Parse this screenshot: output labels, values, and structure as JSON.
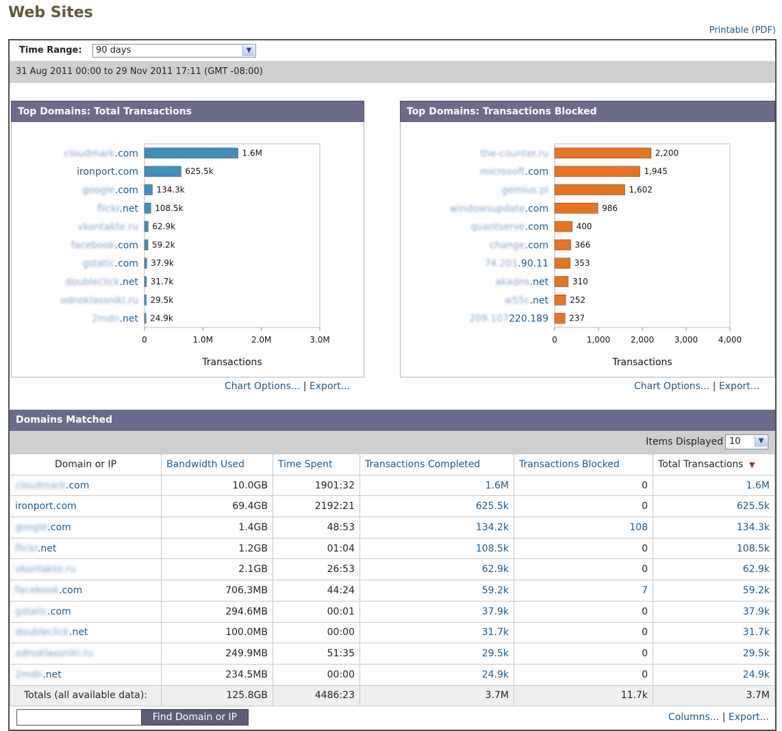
{
  "page": {
    "title": "Web Sites",
    "printable_link": "Printable (PDF)"
  },
  "time_range": {
    "label": "Time Range:",
    "selected": "90 days",
    "date_span": "31 Aug 2011 00:00 to 29 Nov 2011 17:11 (GMT -08:00)"
  },
  "links": {
    "chart_options": "Chart Options...",
    "export": "Export...",
    "separator": "|",
    "columns": "Columns..."
  },
  "colors": {
    "header_bar": "#6b6b8c",
    "bar_total": "#3f8fbf",
    "bar_blocked": "#ea7320",
    "link": "#1b5a8c"
  },
  "chart_data": [
    {
      "type": "bar",
      "orientation": "horizontal",
      "title": "Top Domains: Total Transactions",
      "xlabel": "Transactions",
      "categories": [
        {
          "prefix": "cloudmark",
          "suffix": ".com"
        },
        {
          "prefix": "",
          "suffix": "ironport.com"
        },
        {
          "prefix": "google",
          "suffix": ".com"
        },
        {
          "prefix": "flickr",
          "suffix": ".net"
        },
        {
          "prefix": "vkontakte.ru",
          "suffix": ""
        },
        {
          "prefix": "facebook",
          "suffix": ".com"
        },
        {
          "prefix": "gstatic",
          "suffix": ".com"
        },
        {
          "prefix": "doubleclick",
          "suffix": ".net"
        },
        {
          "prefix": "odnoklassniki.ru",
          "suffix": ""
        },
        {
          "prefix": "2mdn",
          "suffix": ".net"
        }
      ],
      "values": [
        1600000,
        625500,
        134300,
        108500,
        62900,
        59200,
        37900,
        31700,
        29500,
        24900
      ],
      "value_labels": [
        "1.6M",
        "625.5k",
        "134.3k",
        "108.5k",
        "62.9k",
        "59.2k",
        "37.9k",
        "31.7k",
        "29.5k",
        "24.9k"
      ],
      "xlim": [
        0,
        3000000
      ],
      "xticks": [
        0,
        1000000,
        2000000,
        3000000
      ],
      "xtick_labels": [
        "0",
        "1.0M",
        "2.0M",
        "3.0M"
      ],
      "color": "#3f8fbf"
    },
    {
      "type": "bar",
      "orientation": "horizontal",
      "title": "Top Domains: Transactions Blocked",
      "xlabel": "Transactions",
      "categories": [
        {
          "prefix": "the-counter.ru",
          "suffix": ""
        },
        {
          "prefix": "microsoft",
          "suffix": ".com"
        },
        {
          "prefix": "gemius.pl",
          "suffix": ""
        },
        {
          "prefix": "windowsupdate",
          "suffix": ".com"
        },
        {
          "prefix": "quantserve",
          "suffix": ".com"
        },
        {
          "prefix": "change",
          "suffix": ".com"
        },
        {
          "prefix": "74.201",
          "suffix": ".90.11"
        },
        {
          "prefix": "akadns",
          "suffix": ".net"
        },
        {
          "prefix": "w55c",
          "suffix": ".net"
        },
        {
          "prefix": "209.107",
          "suffix": "220.189"
        }
      ],
      "values": [
        2200,
        1945,
        1602,
        986,
        400,
        366,
        353,
        310,
        252,
        237
      ],
      "value_labels": [
        "2,200",
        "1,945",
        "1,602",
        "986",
        "400",
        "366",
        "353",
        "310",
        "252",
        "237"
      ],
      "xlim": [
        0,
        4000
      ],
      "xticks": [
        0,
        1000,
        2000,
        3000,
        4000
      ],
      "xtick_labels": [
        "0",
        "1,000",
        "2,000",
        "3,000",
        "4,000"
      ],
      "color": "#ea7320"
    }
  ],
  "domains": {
    "title": "Domains Matched",
    "items_label": "Items Displayed",
    "items_value": "10",
    "columns": [
      "Domain or IP",
      "Bandwidth Used",
      "Time Spent",
      "Transactions Completed",
      "Transactions Blocked",
      "Total Transactions"
    ],
    "sort_indicator": "▼",
    "rows": [
      {
        "prefix": "cloudmark",
        "suffix": ".com",
        "bandwidth": "10.0GB",
        "time": "1901:32",
        "completed": "1.6M",
        "blocked": "0",
        "total": "1.6M"
      },
      {
        "prefix": "",
        "suffix": "ironport.com",
        "bandwidth": "69.4GB",
        "time": "2192:21",
        "completed": "625.5k",
        "blocked": "0",
        "total": "625.5k"
      },
      {
        "prefix": "google",
        "suffix": ".com",
        "bandwidth": "1.4GB",
        "time": "48:53",
        "completed": "134.2k",
        "blocked": "108",
        "total": "134.3k"
      },
      {
        "prefix": "flickr",
        "suffix": ".net",
        "bandwidth": "1.2GB",
        "time": "01:04",
        "completed": "108.5k",
        "blocked": "0",
        "total": "108.5k"
      },
      {
        "prefix": "vkontakte.ru",
        "suffix": "",
        "bandwidth": "2.1GB",
        "time": "26:53",
        "completed": "62.9k",
        "blocked": "0",
        "total": "62.9k"
      },
      {
        "prefix": "facebook",
        "suffix": ".com",
        "bandwidth": "706.3MB",
        "time": "44:24",
        "completed": "59.2k",
        "blocked": "7",
        "total": "59.2k"
      },
      {
        "prefix": "gstatic",
        "suffix": ".com",
        "bandwidth": "294.6MB",
        "time": "00:01",
        "completed": "37.9k",
        "blocked": "0",
        "total": "37.9k"
      },
      {
        "prefix": "doubleclick",
        "suffix": ".net",
        "bandwidth": "100.0MB",
        "time": "00:00",
        "completed": "31.7k",
        "blocked": "0",
        "total": "31.7k"
      },
      {
        "prefix": "odnoklassniki.ru",
        "suffix": "",
        "bandwidth": "249.9MB",
        "time": "51:35",
        "completed": "29.5k",
        "blocked": "0",
        "total": "29.5k"
      },
      {
        "prefix": "2mdn",
        "suffix": ".net",
        "bandwidth": "234.5MB",
        "time": "00:00",
        "completed": "24.9k",
        "blocked": "0",
        "total": "24.9k"
      }
    ],
    "totals": {
      "label": "Totals (all available data):",
      "bandwidth": "125.8GB",
      "time": "4486:23",
      "completed": "3.7M",
      "blocked": "11.7k",
      "total": "3.7M"
    }
  },
  "search": {
    "input_value": "",
    "button_label": "Find Domain or IP"
  }
}
